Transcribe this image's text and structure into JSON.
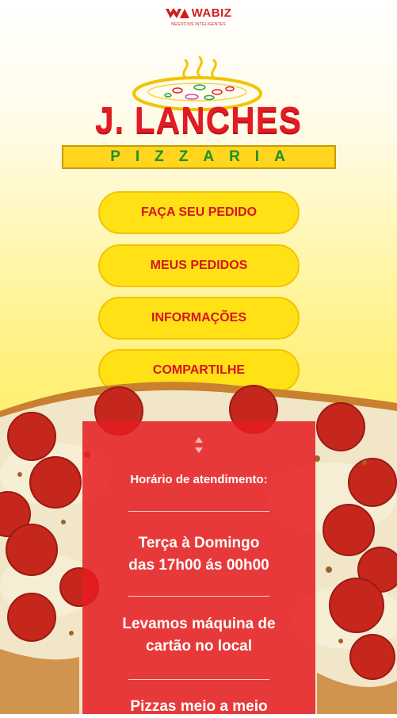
{
  "brand_header": {
    "name": "WABIZ",
    "tagline": "NEGÓCIOS INTELIGENTES"
  },
  "logo": {
    "title": "J. LANCHES",
    "subtitle": "PIZZARIA"
  },
  "menu": [
    {
      "label": "FAÇA SEU PEDIDO"
    },
    {
      "label": "MEUS PEDIDOS"
    },
    {
      "label": "INFORMAÇÕES"
    },
    {
      "label": "COMPARTILHE"
    }
  ],
  "info_panel": {
    "hours_label": "Horário de atendimento:",
    "hours_days": "Terça à Domingo",
    "hours_time": "das 17h00 ás 00h00",
    "card_line1": "Levamos máquina de",
    "card_line2": "cartão no local",
    "half_pizza": "Pizzas meio a meio"
  },
  "colors": {
    "accent_red": "#e31b23",
    "button_yellow": "#ffe116",
    "subtitle_green": "#1f8f2c"
  }
}
